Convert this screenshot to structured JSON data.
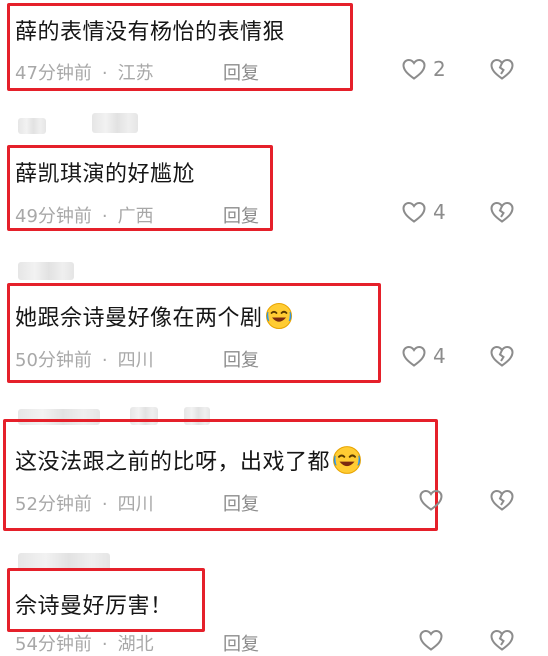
{
  "comments": [
    {
      "text": "薛的表情没有杨怡的表情狠",
      "time": "47分钟前",
      "dot": "·",
      "location": "江苏",
      "reply": "回复",
      "likes": "2",
      "emoji": ""
    },
    {
      "text": "薛凯琪演的好尴尬",
      "time": "49分钟前",
      "dot": "·",
      "location": "广西",
      "reply": "回复",
      "likes": "4",
      "emoji": ""
    },
    {
      "text": "她跟佘诗曼好像在两个剧",
      "time": "50分钟前",
      "dot": "·",
      "location": "四川",
      "reply": "回复",
      "likes": "4",
      "emoji": "laughing-crying-emoji"
    },
    {
      "text": "这没法跟之前的比呀，出戏了都",
      "time": "52分钟前",
      "dot": "·",
      "location": "四川",
      "reply": "回复",
      "likes": "",
      "emoji": "laughing-crying-emoji"
    },
    {
      "text": "佘诗曼好厉害！",
      "time": "54分钟前",
      "dot": "·",
      "location": "湖北",
      "reply": "回复",
      "likes": "",
      "emoji": ""
    }
  ],
  "colors": {
    "highlight_border": "#e5202a",
    "text": "#161616",
    "meta": "#a8a8a8",
    "icon": "#8c8c8c"
  },
  "icons": {
    "like": "heart-outline-icon",
    "dislike": "broken-heart-icon"
  }
}
